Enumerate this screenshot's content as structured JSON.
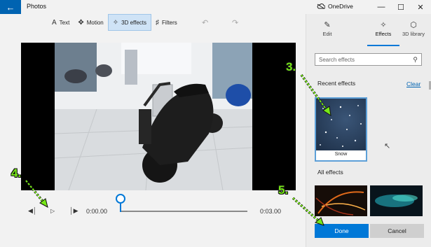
{
  "titlebar": {
    "back_icon": "arrow-left-icon",
    "title": "Photos",
    "onedrive_label": "OneDrive",
    "controls": [
      "—",
      "☐",
      "✕"
    ]
  },
  "toolbar": {
    "text_label": "Text",
    "motion_label": "Motion",
    "effects_label": "3D effects",
    "filters_label": "Filters"
  },
  "playback": {
    "current_time": "0:00.00",
    "end_time": "0:03.00",
    "progress": 0
  },
  "panel": {
    "tabs": [
      {
        "label": "Edit",
        "icon": "pencil-icon"
      },
      {
        "label": "Effects",
        "icon": "sparkle-icon"
      },
      {
        "label": "3D library",
        "icon": "cube-icon"
      }
    ],
    "search_placeholder": "Search effects",
    "recent_title": "Recent effects",
    "clear_label": "Clear",
    "recent_effects": [
      {
        "label": "Snow"
      }
    ],
    "all_title": "All effects",
    "done_label": "Done",
    "cancel_label": "Cancel"
  },
  "annotations": {
    "step3": "3.",
    "step4": "4.",
    "step5": "5."
  },
  "colors": {
    "accent": "#0078d7",
    "annotation": "#76e817"
  }
}
